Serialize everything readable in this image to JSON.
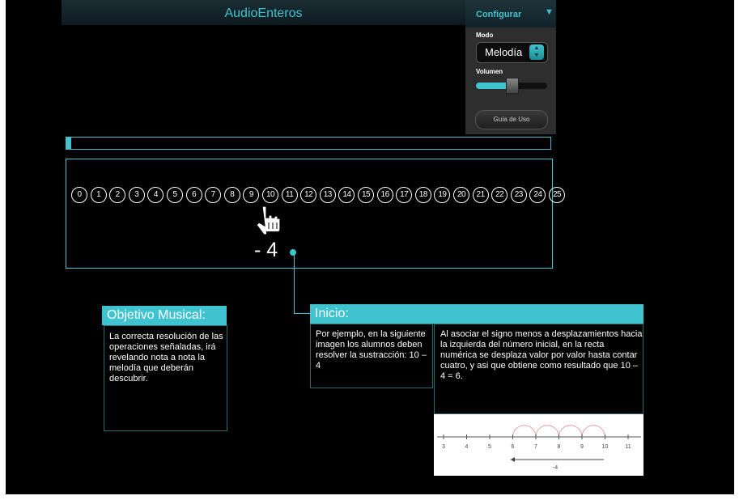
{
  "app": {
    "title": "AudioEnteros"
  },
  "config": {
    "header_label": "Configurar",
    "toggle_icon": "triangle-down-icon",
    "mode_label": "Modo",
    "mode_value": "Melodía",
    "volume_label": "Volumen",
    "volume_level": 0.5,
    "guide_button": "Guía de Uso"
  },
  "progress": {
    "fraction": 0.01
  },
  "number_line": {
    "numbers": [
      "0",
      "1",
      "2",
      "3",
      "4",
      "5",
      "6",
      "7",
      "8",
      "9",
      "10",
      "11",
      "12",
      "13",
      "14",
      "15",
      "16",
      "17",
      "18",
      "19",
      "20",
      "21",
      "22",
      "23",
      "24",
      "25"
    ],
    "operation": "- 4",
    "cursor_icon": "hand-pointer-icon"
  },
  "objetivo": {
    "title": "Objetivo Musical:",
    "text": "La correcta resolución de las operaciones señaladas, irá revelando nota a nota la melodía que deberán descubrir."
  },
  "inicio": {
    "title": "Inicio:",
    "left_text": "Por ejemplo, en la siguiente imagen los alumnos deben resolver la sustracción: 10 – 4",
    "right_text": "Al asociar el signo menos a desplazamientos hacia la izquierda del número inicial, en la recta numérica se desplaza valor por valor hasta contar cuatro, y asi que obtiene como resultado que 10 – 4 = 6."
  },
  "example": {
    "ticks": [
      "3",
      "4",
      "5",
      "6",
      "7",
      "8",
      "9",
      "10",
      "11"
    ],
    "arrow_label": "-4",
    "arc_color": "#e0a0a0"
  },
  "colors": {
    "accent": "#3fc3cf",
    "background": "#000000",
    "panel": "#2e2e2e"
  }
}
